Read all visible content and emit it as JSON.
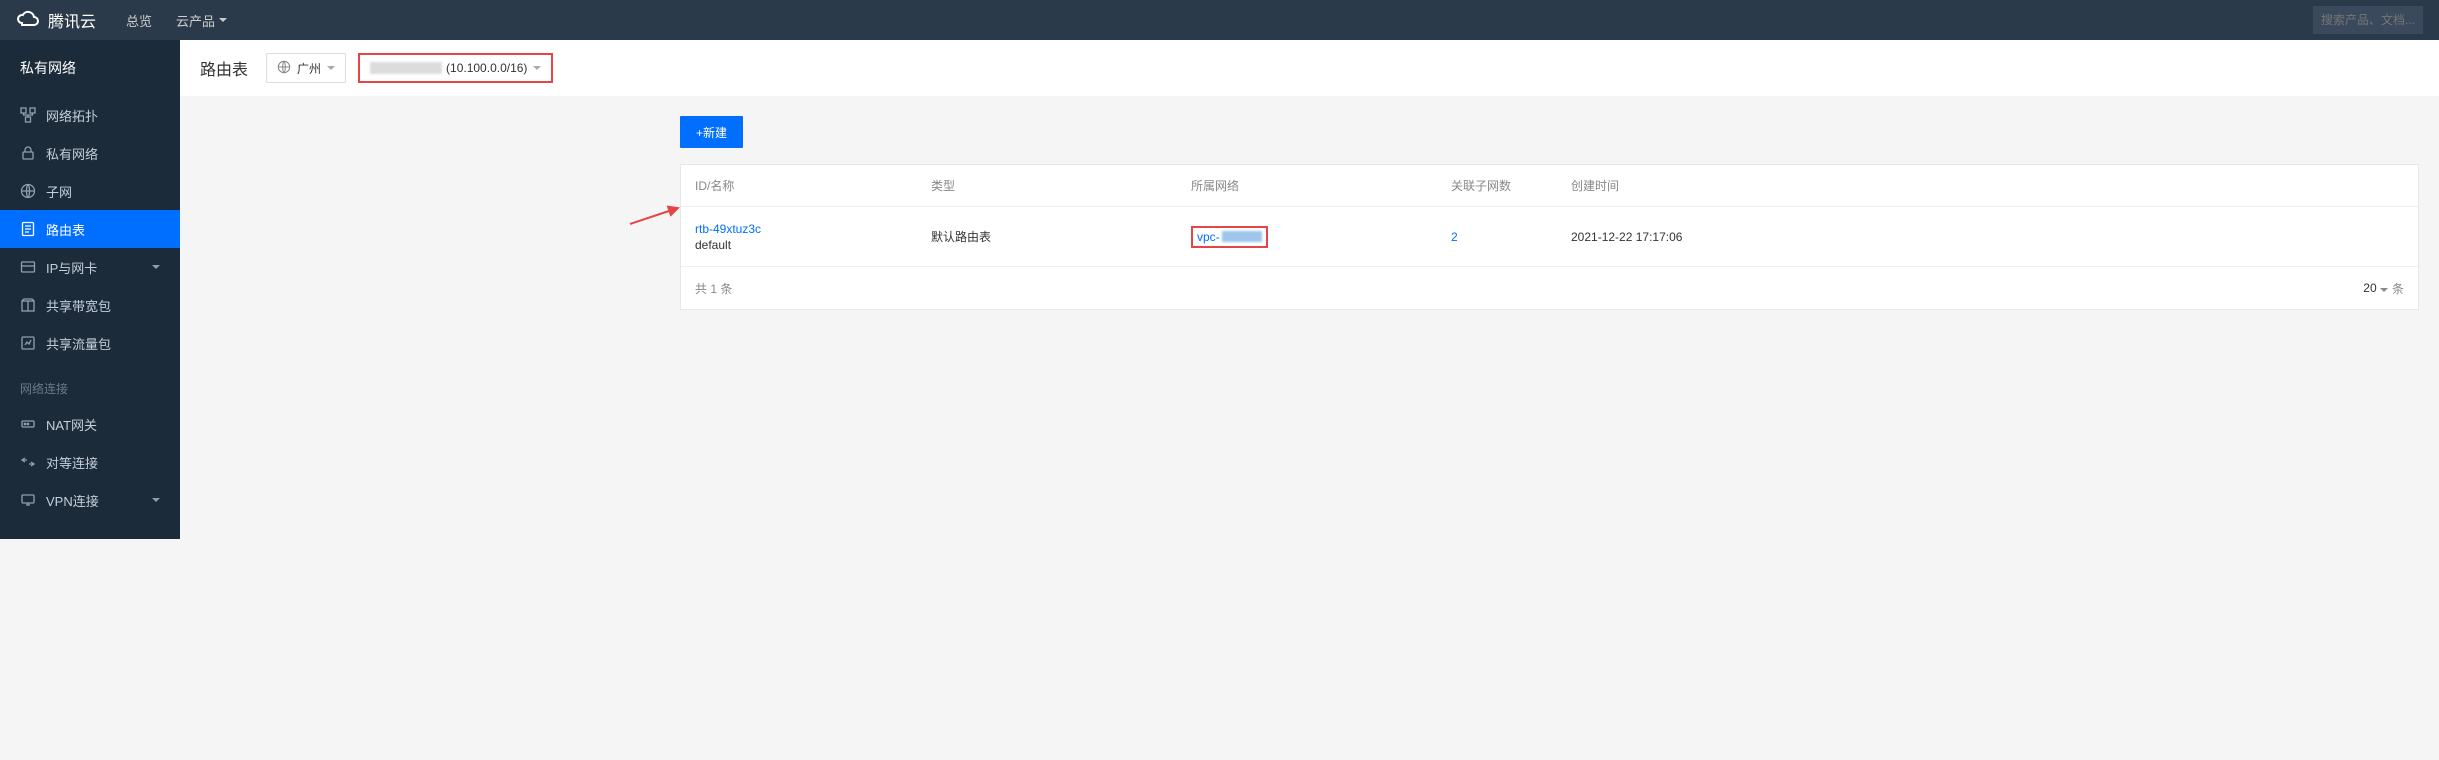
{
  "brand": "腾讯云",
  "topnav": {
    "overview": "总览",
    "products": "云产品"
  },
  "search": {
    "placeholder": "搜索产品、文档..."
  },
  "sidebar": {
    "title": "私有网络",
    "items": [
      {
        "label": "网络拓扑"
      },
      {
        "label": "私有网络"
      },
      {
        "label": "子网"
      },
      {
        "label": "路由表"
      },
      {
        "label": "IP与网卡"
      },
      {
        "label": "共享带宽包"
      },
      {
        "label": "共享流量包"
      }
    ],
    "group": "网络连接",
    "group_items": [
      {
        "label": "NAT网关"
      },
      {
        "label": "对等连接"
      },
      {
        "label": "VPN连接"
      }
    ]
  },
  "page": {
    "title": "路由表",
    "region": "广州",
    "vpc_cidr": "(10.100.0.0/16)",
    "new_btn": "+新建"
  },
  "table": {
    "headers": {
      "id": "ID/名称",
      "type": "类型",
      "network": "所属网络",
      "subnets": "关联子网数",
      "created": "创建时间"
    },
    "rows": [
      {
        "id": "rtb-49xtuz3c",
        "name": "default",
        "type": "默认路由表",
        "network_prefix": "vpc-",
        "subnets": "2",
        "created": "2021-12-22 17:17:06"
      }
    ]
  },
  "pager": {
    "total_prefix": "共 ",
    "total_count": "1",
    "total_suffix": " 条",
    "page_size": "20",
    "per_page_suffix": "条"
  }
}
